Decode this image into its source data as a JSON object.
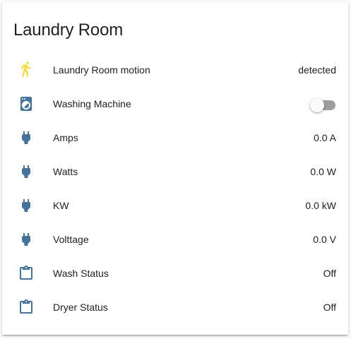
{
  "card": {
    "title": "Laundry Room"
  },
  "colors": {
    "icon_default": "#44739e",
    "icon_active": "#fdd835",
    "toggle_track_off": "#9e9e9e",
    "toggle_thumb_off": "#fafafa"
  },
  "entities": [
    {
      "name": "Laundry Room motion",
      "state": "detected",
      "icon": "walk-icon"
    },
    {
      "name": "Washing Machine",
      "state": "off",
      "icon": "washing-machine-icon"
    },
    {
      "name": "Amps",
      "state": "0.0 A",
      "icon": "power-plug-icon"
    },
    {
      "name": "Watts",
      "state": "0.0 W",
      "icon": "power-plug-icon"
    },
    {
      "name": "KW",
      "state": "0.0 kW",
      "icon": "power-plug-icon"
    },
    {
      "name": "Volttage",
      "state": "0.0 V",
      "icon": "power-plug-icon"
    },
    {
      "name": "Wash Status",
      "state": "Off",
      "icon": "clipboard-icon"
    },
    {
      "name": "Dryer Status",
      "state": "Off",
      "icon": "clipboard-icon"
    }
  ]
}
